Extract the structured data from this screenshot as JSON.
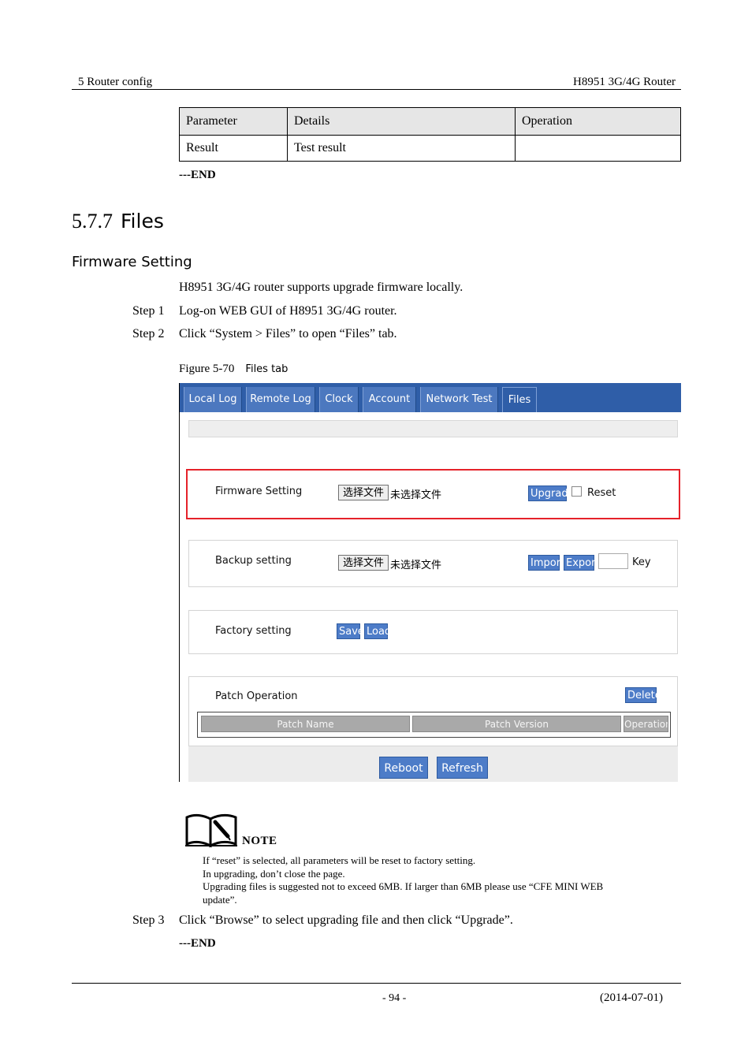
{
  "header": {
    "left": "5 Router config",
    "right": "H8951 3G/4G Router"
  },
  "param_table": {
    "headers": [
      "Parameter",
      "Details",
      "Operation"
    ],
    "rows": [
      [
        "Result",
        "Test result",
        ""
      ]
    ]
  },
  "end_marker_1": "---END",
  "section": {
    "number": "5.7.7",
    "title": "Files"
  },
  "subsection": "Firmware Setting",
  "intro": "H8951 3G/4G router supports upgrade firmware locally.",
  "steps": [
    {
      "label": "Step 1",
      "text": "Log-on WEB GUI of H8951 3G/4G router."
    },
    {
      "label": "Step 2",
      "text": "Click “System > Files” to open “Files” tab."
    }
  ],
  "figure": {
    "number": "Figure 5-70",
    "title": "Files tab"
  },
  "screenshot": {
    "tabs": [
      "Local Log",
      "Remote Log",
      "Clock",
      "Account",
      "Network Test",
      "Files"
    ],
    "active_tab": "Files",
    "firmware": {
      "label": "Firmware Setting",
      "choose": "选择文件",
      "nofile": "未选择文件",
      "upgrade": "Upgrade",
      "reset": "Reset"
    },
    "backup": {
      "label": "Backup setting",
      "choose": "选择文件",
      "nofile": "未选择文件",
      "import": "Import",
      "export": "Export",
      "key": "Key"
    },
    "factory": {
      "label": "Factory setting",
      "save": "Save",
      "load": "Load"
    },
    "patch": {
      "label": "Patch Operation",
      "delete": "Delete",
      "columns": [
        "Patch Name",
        "Patch Version",
        "Operation"
      ]
    },
    "buttons": {
      "reboot": "Reboot",
      "refresh": "Refresh"
    }
  },
  "note": {
    "label": "NOTE",
    "lines": [
      "If “reset” is selected, all parameters will be reset to factory setting.",
      "In upgrading, don’t close the page.",
      "Upgrading files is suggested not to exceed 6MB. If larger than 6MB please use “CFE MINI WEB",
      "update”."
    ]
  },
  "step3": {
    "label": "Step 3",
    "text": "Click “Browse” to select upgrading file and then click “Upgrade”."
  },
  "end_marker_2": "---END",
  "footer": {
    "page": "- 94 -",
    "date": "(2014-07-01)"
  },
  "colors": {
    "tab_bar": "#2f5ea8",
    "button": "#4d7cc8",
    "highlight": "#e5222a"
  }
}
